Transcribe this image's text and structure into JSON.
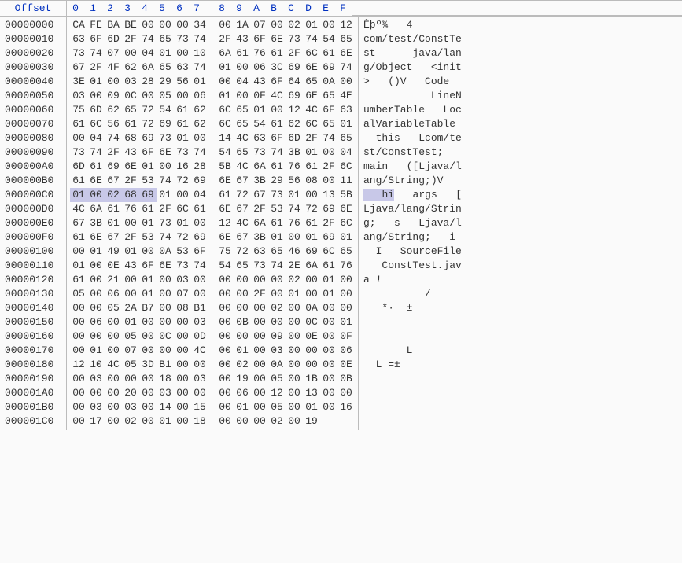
{
  "header": {
    "offset_label": "Offset",
    "columns": [
      "0",
      "1",
      "2",
      "3",
      "4",
      "5",
      "6",
      "7",
      "8",
      "9",
      "A",
      "B",
      "C",
      "D",
      "E",
      "F"
    ]
  },
  "rows": [
    {
      "offset": "00000000",
      "hex": [
        "CA",
        "FE",
        "BA",
        "BE",
        "00",
        "00",
        "00",
        "34",
        "00",
        "1A",
        "07",
        "00",
        "02",
        "01",
        "00",
        "12"
      ],
      "ascii": "Êþº¾   4        "
    },
    {
      "offset": "00000010",
      "hex": [
        "63",
        "6F",
        "6D",
        "2F",
        "74",
        "65",
        "73",
        "74",
        "2F",
        "43",
        "6F",
        "6E",
        "73",
        "74",
        "54",
        "65"
      ],
      "ascii": "com/test/ConstTe"
    },
    {
      "offset": "00000020",
      "hex": [
        "73",
        "74",
        "07",
        "00",
        "04",
        "01",
        "00",
        "10",
        "6A",
        "61",
        "76",
        "61",
        "2F",
        "6C",
        "61",
        "6E"
      ],
      "ascii": "st      java/lan"
    },
    {
      "offset": "00000030",
      "hex": [
        "67",
        "2F",
        "4F",
        "62",
        "6A",
        "65",
        "63",
        "74",
        "01",
        "00",
        "06",
        "3C",
        "69",
        "6E",
        "69",
        "74"
      ],
      "ascii": "g/Object   <init"
    },
    {
      "offset": "00000040",
      "hex": [
        "3E",
        "01",
        "00",
        "03",
        "28",
        "29",
        "56",
        "01",
        "00",
        "04",
        "43",
        "6F",
        "64",
        "65",
        "0A",
        "00"
      ],
      "ascii": ">   ()V   Code  "
    },
    {
      "offset": "00000050",
      "hex": [
        "03",
        "00",
        "09",
        "0C",
        "00",
        "05",
        "00",
        "06",
        "01",
        "00",
        "0F",
        "4C",
        "69",
        "6E",
        "65",
        "4E"
      ],
      "ascii": "           LineN"
    },
    {
      "offset": "00000060",
      "hex": [
        "75",
        "6D",
        "62",
        "65",
        "72",
        "54",
        "61",
        "62",
        "6C",
        "65",
        "01",
        "00",
        "12",
        "4C",
        "6F",
        "63"
      ],
      "ascii": "umberTable   Loc"
    },
    {
      "offset": "00000070",
      "hex": [
        "61",
        "6C",
        "56",
        "61",
        "72",
        "69",
        "61",
        "62",
        "6C",
        "65",
        "54",
        "61",
        "62",
        "6C",
        "65",
        "01"
      ],
      "ascii": "alVariableTable "
    },
    {
      "offset": "00000080",
      "hex": [
        "00",
        "04",
        "74",
        "68",
        "69",
        "73",
        "01",
        "00",
        "14",
        "4C",
        "63",
        "6F",
        "6D",
        "2F",
        "74",
        "65"
      ],
      "ascii": "  this   Lcom/te"
    },
    {
      "offset": "00000090",
      "hex": [
        "73",
        "74",
        "2F",
        "43",
        "6F",
        "6E",
        "73",
        "74",
        "54",
        "65",
        "73",
        "74",
        "3B",
        "01",
        "00",
        "04"
      ],
      "ascii": "st/ConstTest;   "
    },
    {
      "offset": "000000A0",
      "hex": [
        "6D",
        "61",
        "69",
        "6E",
        "01",
        "00",
        "16",
        "28",
        "5B",
        "4C",
        "6A",
        "61",
        "76",
        "61",
        "2F",
        "6C"
      ],
      "ascii": "main   ([Ljava/l"
    },
    {
      "offset": "000000B0",
      "hex": [
        "61",
        "6E",
        "67",
        "2F",
        "53",
        "74",
        "72",
        "69",
        "6E",
        "67",
        "3B",
        "29",
        "56",
        "08",
        "00",
        "11"
      ],
      "ascii": "ang/String;)V   "
    },
    {
      "offset": "000000C0",
      "hex": [
        "01",
        "00",
        "02",
        "68",
        "69",
        "01",
        "00",
        "04",
        "61",
        "72",
        "67",
        "73",
        "01",
        "00",
        "13",
        "5B"
      ],
      "ascii": "   hi   args   [",
      "highlight": {
        "hex": [
          0,
          1,
          2,
          3,
          4
        ],
        "ascii": [
          0,
          1,
          2,
          3,
          4
        ]
      }
    },
    {
      "offset": "000000D0",
      "hex": [
        "4C",
        "6A",
        "61",
        "76",
        "61",
        "2F",
        "6C",
        "61",
        "6E",
        "67",
        "2F",
        "53",
        "74",
        "72",
        "69",
        "6E"
      ],
      "ascii": "Ljava/lang/Strin"
    },
    {
      "offset": "000000E0",
      "hex": [
        "67",
        "3B",
        "01",
        "00",
        "01",
        "73",
        "01",
        "00",
        "12",
        "4C",
        "6A",
        "61",
        "76",
        "61",
        "2F",
        "6C"
      ],
      "ascii": "g;   s   Ljava/l"
    },
    {
      "offset": "000000F0",
      "hex": [
        "61",
        "6E",
        "67",
        "2F",
        "53",
        "74",
        "72",
        "69",
        "6E",
        "67",
        "3B",
        "01",
        "00",
        "01",
        "69",
        "01"
      ],
      "ascii": "ang/String;   i "
    },
    {
      "offset": "00000100",
      "hex": [
        "00",
        "01",
        "49",
        "01",
        "00",
        "0A",
        "53",
        "6F",
        "75",
        "72",
        "63",
        "65",
        "46",
        "69",
        "6C",
        "65"
      ],
      "ascii": "  I   SourceFile"
    },
    {
      "offset": "00000110",
      "hex": [
        "01",
        "00",
        "0E",
        "43",
        "6F",
        "6E",
        "73",
        "74",
        "54",
        "65",
        "73",
        "74",
        "2E",
        "6A",
        "61",
        "76"
      ],
      "ascii": "   ConstTest.jav"
    },
    {
      "offset": "00000120",
      "hex": [
        "61",
        "00",
        "21",
        "00",
        "01",
        "00",
        "03",
        "00",
        "00",
        "00",
        "00",
        "00",
        "02",
        "00",
        "01",
        "00"
      ],
      "ascii": "a !             "
    },
    {
      "offset": "00000130",
      "hex": [
        "05",
        "00",
        "06",
        "00",
        "01",
        "00",
        "07",
        "00",
        "00",
        "00",
        "2F",
        "00",
        "01",
        "00",
        "01",
        "00"
      ],
      "ascii": "          /     "
    },
    {
      "offset": "00000140",
      "hex": [
        "00",
        "00",
        "05",
        "2A",
        "B7",
        "00",
        "08",
        "B1",
        "00",
        "00",
        "00",
        "02",
        "00",
        "0A",
        "00",
        "00"
      ],
      "ascii": "   *·  ±        "
    },
    {
      "offset": "00000150",
      "hex": [
        "00",
        "06",
        "00",
        "01",
        "00",
        "00",
        "00",
        "03",
        "00",
        "0B",
        "00",
        "00",
        "00",
        "0C",
        "00",
        "01"
      ],
      "ascii": "                "
    },
    {
      "offset": "00000160",
      "hex": [
        "00",
        "00",
        "00",
        "05",
        "00",
        "0C",
        "00",
        "0D",
        "00",
        "00",
        "00",
        "09",
        "00",
        "0E",
        "00",
        "0F"
      ],
      "ascii": "                "
    },
    {
      "offset": "00000170",
      "hex": [
        "00",
        "01",
        "00",
        "07",
        "00",
        "00",
        "00",
        "4C",
        "00",
        "01",
        "00",
        "03",
        "00",
        "00",
        "00",
        "06"
      ],
      "ascii": "       L        "
    },
    {
      "offset": "00000180",
      "hex": [
        "12",
        "10",
        "4C",
        "05",
        "3D",
        "B1",
        "00",
        "00",
        "00",
        "02",
        "00",
        "0A",
        "00",
        "00",
        "00",
        "0E"
      ],
      "ascii": "  L =±          "
    },
    {
      "offset": "00000190",
      "hex": [
        "00",
        "03",
        "00",
        "00",
        "00",
        "18",
        "00",
        "03",
        "00",
        "19",
        "00",
        "05",
        "00",
        "1B",
        "00",
        "0B"
      ],
      "ascii": "                "
    },
    {
      "offset": "000001A0",
      "hex": [
        "00",
        "00",
        "00",
        "20",
        "00",
        "03",
        "00",
        "00",
        "00",
        "06",
        "00",
        "12",
        "00",
        "13",
        "00",
        "00"
      ],
      "ascii": "                "
    },
    {
      "offset": "000001B0",
      "hex": [
        "00",
        "03",
        "00",
        "03",
        "00",
        "14",
        "00",
        "15",
        "00",
        "01",
        "00",
        "05",
        "00",
        "01",
        "00",
        "16"
      ],
      "ascii": "                "
    },
    {
      "offset": "000001C0",
      "hex": [
        "00",
        "17",
        "00",
        "02",
        "00",
        "01",
        "00",
        "18",
        "00",
        "00",
        "00",
        "02",
        "00",
        "19"
      ],
      "ascii": "              "
    }
  ]
}
